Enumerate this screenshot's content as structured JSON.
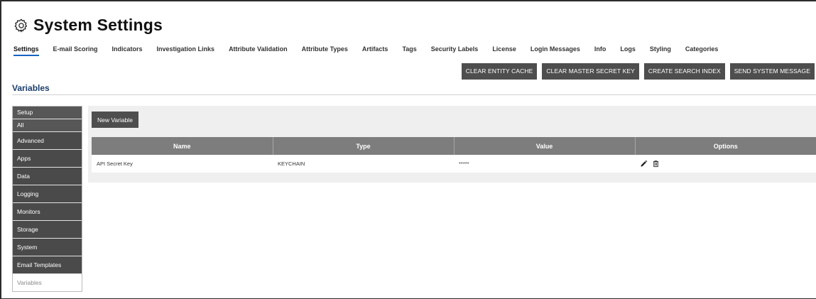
{
  "header": {
    "title": "System Settings",
    "icon": "gear-icon"
  },
  "tabs": [
    {
      "label": "Settings",
      "active": true
    },
    {
      "label": "E-mail Scoring"
    },
    {
      "label": "Indicators"
    },
    {
      "label": "Investigation Links"
    },
    {
      "label": "Attribute Validation"
    },
    {
      "label": "Attribute Types"
    },
    {
      "label": "Artifacts"
    },
    {
      "label": "Tags"
    },
    {
      "label": "Security Labels"
    },
    {
      "label": "License"
    },
    {
      "label": "Login Messages"
    },
    {
      "label": "Info"
    },
    {
      "label": "Logs"
    },
    {
      "label": "Styling"
    },
    {
      "label": "Categories"
    }
  ],
  "actions": {
    "clear_entity_cache": "CLEAR ENTITY CACHE",
    "clear_master_secret_key": "CLEAR MASTER SECRET KEY",
    "create_search_index": "CREATE SEARCH INDEX",
    "send_system_message": "SEND SYSTEM MESSAGE"
  },
  "section": {
    "title": "Variables"
  },
  "sidebar": {
    "items": [
      {
        "label": "Setup"
      },
      {
        "label": "All"
      },
      {
        "label": "Advanced"
      },
      {
        "label": "Apps"
      },
      {
        "label": "Data"
      },
      {
        "label": "Logging"
      },
      {
        "label": "Monitors"
      },
      {
        "label": "Storage"
      },
      {
        "label": "System"
      },
      {
        "label": "Email Templates"
      },
      {
        "label": "Variables",
        "active": true
      }
    ]
  },
  "main": {
    "new_variable_label": "New Variable",
    "table": {
      "columns": [
        "Name",
        "Type",
        "Value",
        "Options"
      ],
      "rows": [
        {
          "name": "API Secret Key",
          "type": "KEYCHAIN",
          "value": "*****",
          "options": [
            "pencil-icon",
            "trash-icon"
          ]
        }
      ]
    }
  },
  "colors": {
    "button_bg": "#4e4e4e",
    "table_header_bg": "#7d7d7d",
    "active_tab_underline": "#1565c0",
    "section_title": "#1a3d6b"
  }
}
